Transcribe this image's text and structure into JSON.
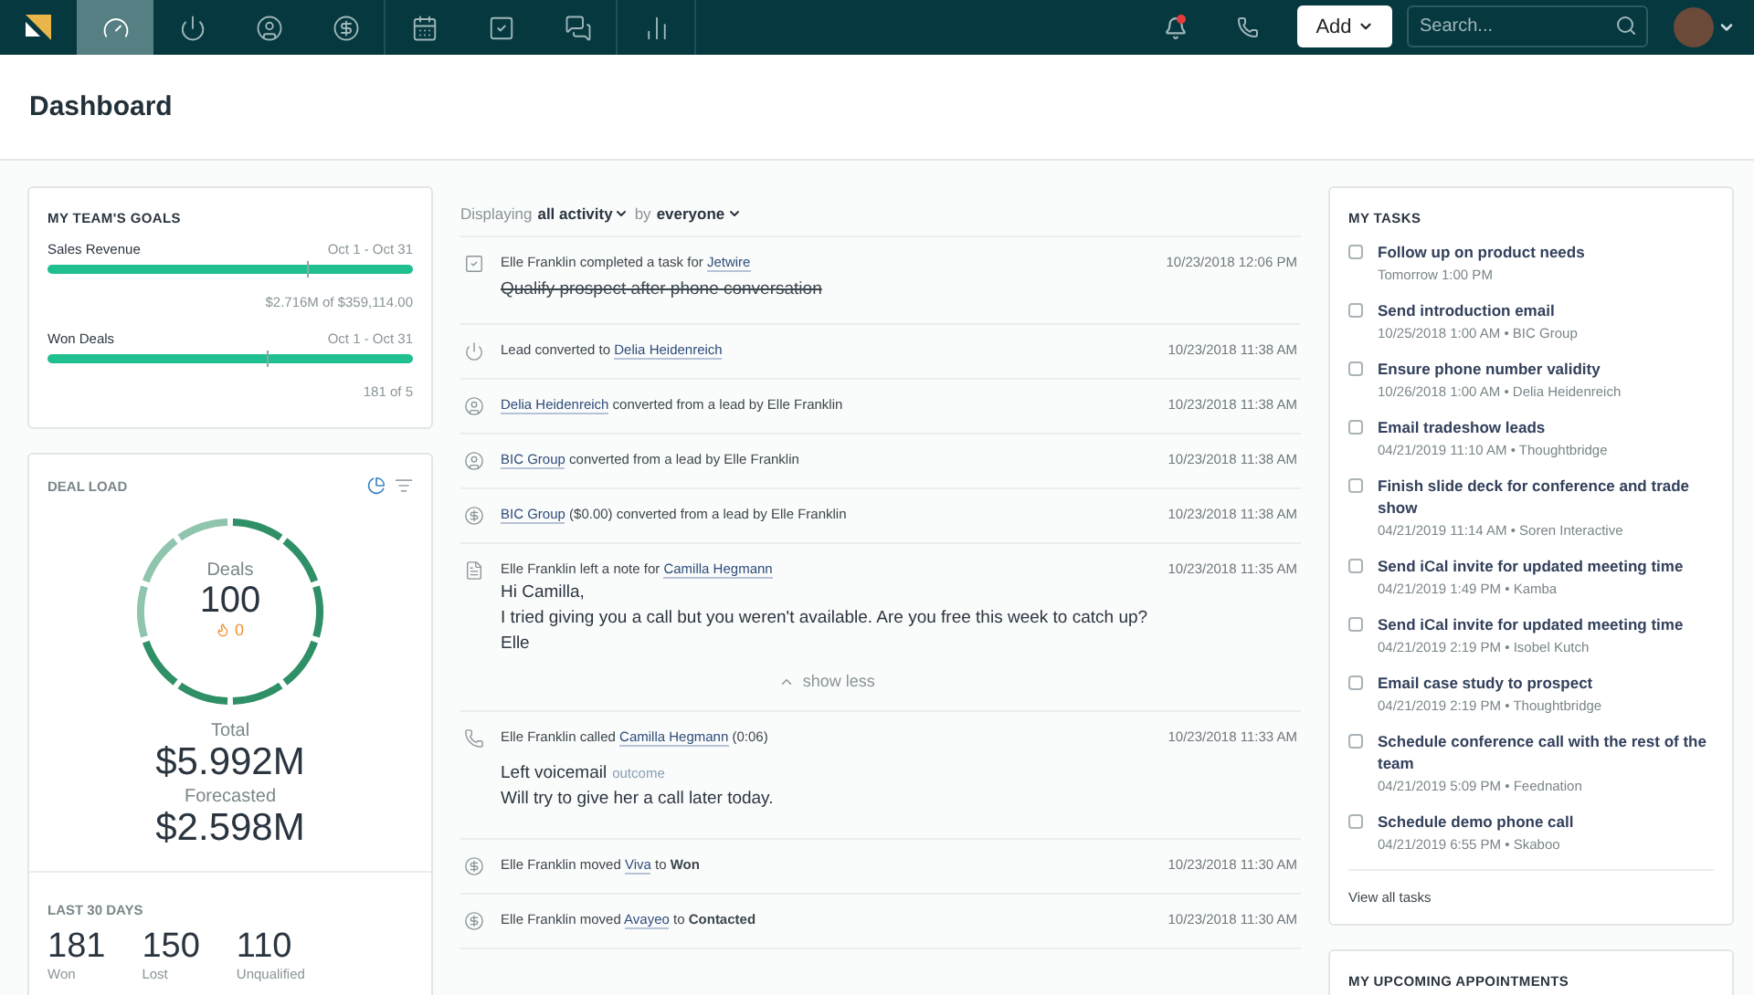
{
  "nav": {
    "groups": [
      [
        {
          "kind": "dashboard",
          "selected": true
        },
        {
          "kind": "leads",
          "selected": false
        },
        {
          "kind": "contacts",
          "selected": false
        },
        {
          "kind": "deals",
          "selected": false
        }
      ],
      [
        {
          "kind": "calendar",
          "selected": false
        },
        {
          "kind": "tasks",
          "selected": false
        },
        {
          "kind": "messages",
          "selected": false
        }
      ],
      [
        {
          "kind": "reports",
          "selected": false
        }
      ]
    ],
    "notifications": {
      "unread": true
    },
    "add_button": "Add",
    "search": {
      "placeholder": "Search..."
    }
  },
  "page_title": "Dashboard",
  "goals": {
    "title": "MY TEAM'S GOALS",
    "items": [
      {
        "name": "Sales Revenue",
        "period": "Oct 1 - Oct 31",
        "level": 1,
        "pace": {
          "level": 0.71
        },
        "summary": "$2.716M of $359,114.00"
      },
      {
        "name": "Won Deals",
        "period": "Oct 1 - Oct 31",
        "level": 1,
        "pace": {
          "level": 0.6
        },
        "summary": "181 of 5"
      }
    ]
  },
  "deal_load": {
    "title": "DEAL LOAD",
    "center_label": "Deals",
    "center_value": "100",
    "hot_count": "0",
    "total_label": "Total",
    "total_value": "$5.992M",
    "forecast_label": "Forecasted",
    "forecast_value": "$2.598M",
    "last_30": {
      "title": "LAST 30 DAYS",
      "stats": [
        {
          "value": "181",
          "label": "Won"
        },
        {
          "value": "150",
          "label": "Lost"
        },
        {
          "value": "110",
          "label": "Unqualified"
        }
      ]
    }
  },
  "activity": {
    "filter": {
      "prefix": "Displaying",
      "scope": "all activity",
      "joiner": "by",
      "owner": "everyone"
    },
    "entries": [
      {
        "kind": "task",
        "parts": [
          {
            "kind": "text",
            "text": "Elle Franklin completed a task for "
          },
          {
            "kind": "link",
            "text": "Jetwire"
          }
        ],
        "time": "10/23/2018 12:06 PM",
        "detail": {
          "text": "Qualify prospect after phone conversation",
          "done": true
        }
      },
      {
        "kind": "lead",
        "parts": [
          {
            "kind": "text",
            "text": "Lead converted to "
          },
          {
            "kind": "link",
            "text": "Delia Heidenreich"
          }
        ],
        "time": "10/23/2018 11:38 AM"
      },
      {
        "kind": "contact",
        "parts": [
          {
            "kind": "link",
            "text": "Delia Heidenreich"
          },
          {
            "kind": "text",
            "text": " converted from a lead by Elle Franklin"
          }
        ],
        "time": "10/23/2018 11:38 AM"
      },
      {
        "kind": "contact",
        "parts": [
          {
            "kind": "link",
            "text": "BIC Group"
          },
          {
            "kind": "text",
            "text": " converted from a lead by Elle Franklin"
          }
        ],
        "time": "10/23/2018 11:38 AM"
      },
      {
        "kind": "deal",
        "parts": [
          {
            "kind": "link",
            "text": "BIC Group"
          },
          {
            "kind": "text",
            "text": " ($0.00) converted from a lead by Elle Franklin"
          }
        ],
        "time": "10/23/2018 11:38 AM"
      },
      {
        "kind": "note",
        "parts": [
          {
            "kind": "text",
            "text": "Elle Franklin left a note for "
          },
          {
            "kind": "link",
            "text": "Camilla Hegmann"
          }
        ],
        "time": "10/23/2018 11:35 AM",
        "body": [
          "Hi Camilla,",
          "I tried giving you a call but you weren't available. Are you free this week to catch up?",
          "Elle"
        ],
        "toggle": "show less"
      },
      {
        "kind": "call",
        "parts": [
          {
            "kind": "text",
            "text": "Elle Franklin called "
          },
          {
            "kind": "link",
            "text": "Camilla Hegmann"
          },
          {
            "kind": "text",
            "text": " (0:06)"
          }
        ],
        "time": "10/23/2018 11:33 AM",
        "outcome": {
          "value": "Left voicemail",
          "label": "outcome"
        },
        "body": [
          "Will try to give her a call later today."
        ]
      },
      {
        "kind": "deal",
        "parts": [
          {
            "kind": "text",
            "text": "Elle Franklin moved "
          },
          {
            "kind": "link",
            "text": "Viva"
          },
          {
            "kind": "text",
            "text": " to "
          },
          {
            "kind": "strong",
            "text": "Won"
          }
        ],
        "time": "10/23/2018 11:30 AM"
      },
      {
        "kind": "deal",
        "parts": [
          {
            "kind": "text",
            "text": "Elle Franklin moved "
          },
          {
            "kind": "link",
            "text": "Avayeo"
          },
          {
            "kind": "text",
            "text": " to "
          },
          {
            "kind": "strong",
            "text": "Contacted"
          }
        ],
        "time": "10/23/2018 11:30 AM"
      }
    ]
  },
  "tasks": {
    "title": "MY TASKS",
    "items": [
      {
        "title": "Follow up on product needs",
        "meta": "Tomorrow 1:00 PM",
        "checked": false
      },
      {
        "title": "Send introduction email",
        "meta": "10/25/2018 1:00 AM • BIC Group",
        "checked": false
      },
      {
        "title": "Ensure phone number validity",
        "meta": "10/26/2018 1:00 AM • Delia Heidenreich",
        "checked": false
      },
      {
        "title": "Email tradeshow leads",
        "meta": "04/21/2019 11:10 AM • Thoughtbridge",
        "checked": false
      },
      {
        "title": "Finish slide deck for conference and trade show",
        "meta": "04/21/2019 11:14 AM • Soren Interactive",
        "checked": false
      },
      {
        "title": "Send iCal invite for updated meeting time",
        "meta": "04/21/2019 1:49 PM • Kamba",
        "checked": false
      },
      {
        "title": "Send iCal invite for updated meeting time",
        "meta": "04/21/2019 2:19 PM • Isobel Kutch",
        "checked": false
      },
      {
        "title": "Email case study to prospect",
        "meta": "04/21/2019 2:19 PM • Thoughtbridge",
        "checked": false
      },
      {
        "title": "Schedule conference call with the rest of the team",
        "meta": "04/21/2019 5:09 PM • Feednation",
        "checked": false
      },
      {
        "title": "Schedule demo phone call",
        "meta": "04/21/2019 6:55 PM • Skaboo",
        "checked": false
      }
    ],
    "view_all": "View all tasks"
  },
  "appointments": {
    "title": "MY UPCOMING APPOINTMENTS"
  }
}
